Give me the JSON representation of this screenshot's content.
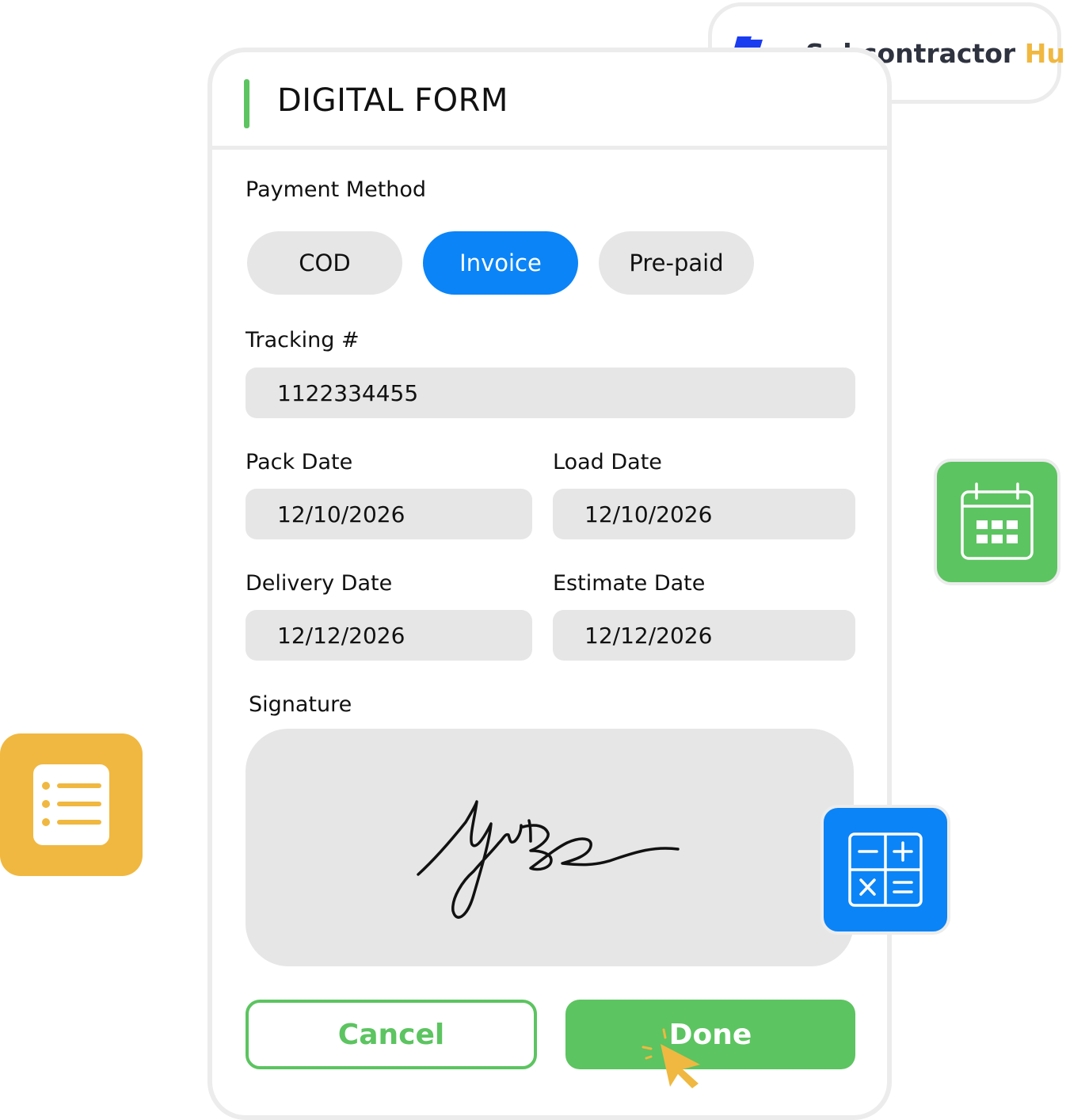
{
  "brand": {
    "name_part1": "Subcontractor",
    "name_part2": "Hub",
    "logo_icon": "subcontractor-hub-logo",
    "colors": {
      "dark": "#2f3340",
      "accent": "#f0b840",
      "blue": "#1a3cf0"
    }
  },
  "form": {
    "title": "DIGITAL FORM",
    "payment_method": {
      "label": "Payment Method",
      "options": [
        "COD",
        "Invoice",
        "Pre-paid"
      ],
      "selected": "Invoice"
    },
    "tracking": {
      "label": "Tracking #",
      "value": "1122334455"
    },
    "pack_date": {
      "label": "Pack Date",
      "value": "12/10/2026"
    },
    "load_date": {
      "label": "Load Date",
      "value": "12/10/2026"
    },
    "delivery_date": {
      "label": "Delivery Date",
      "value": "12/12/2026"
    },
    "estimate_date": {
      "label": "Estimate Date",
      "value": "12/12/2026"
    },
    "signature": {
      "label": "Signature"
    },
    "buttons": {
      "cancel": "Cancel",
      "done": "Done"
    }
  },
  "floating_icons": {
    "calendar": "calendar-icon",
    "list": "list-icon",
    "calculator": "calculator-icon",
    "cursor": "pointer-cursor-icon"
  },
  "colors": {
    "green": "#5cc460",
    "blue": "#0b84f7",
    "yellow": "#f0b840",
    "field_bg": "#e6e6e6",
    "border": "#ececec"
  }
}
